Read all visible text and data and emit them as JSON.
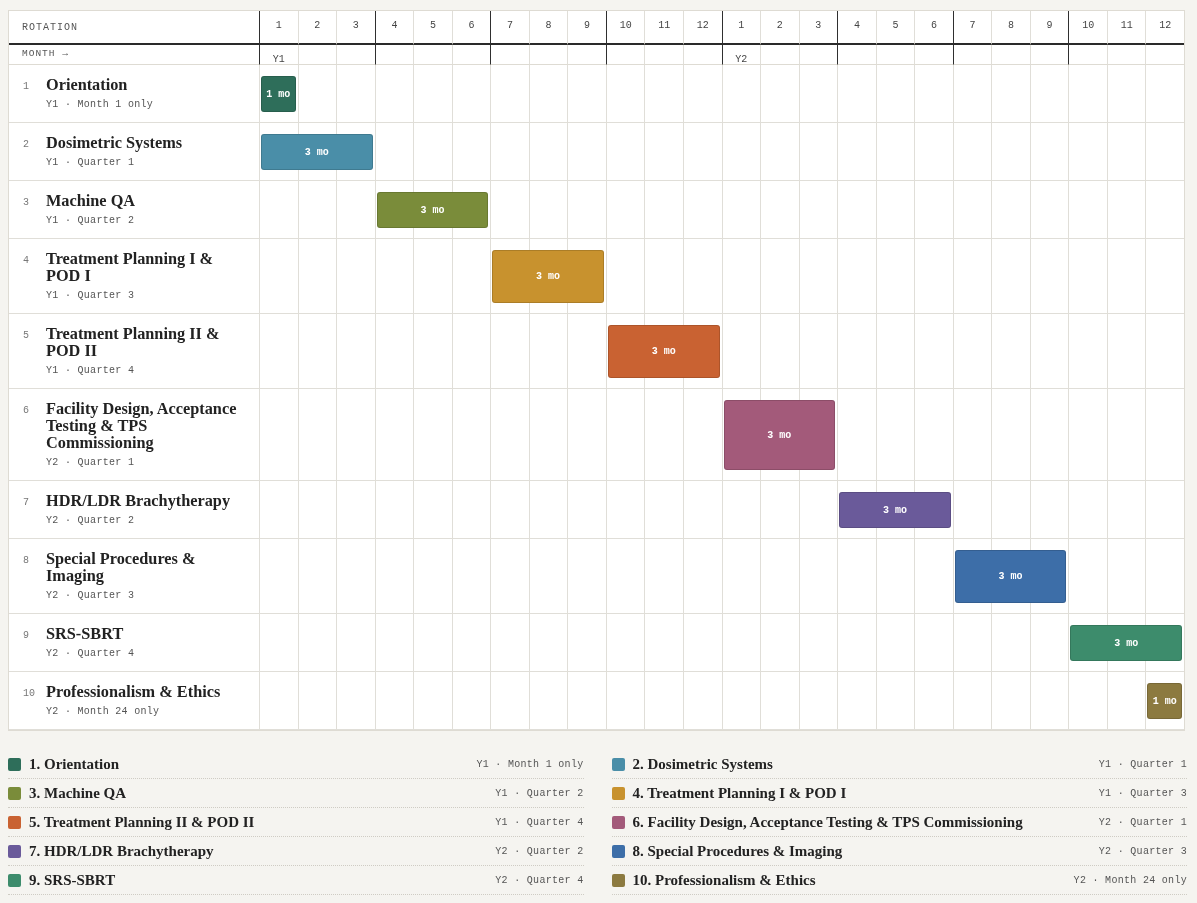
{
  "header": {
    "rotation_label": "ROTATION",
    "month_label": "MONTH →",
    "years": [
      {
        "label": "Y1",
        "months": [
          "1",
          "2",
          "3",
          "4",
          "5",
          "6",
          "7",
          "8",
          "9",
          "10",
          "11",
          "12"
        ]
      },
      {
        "label": "Y2",
        "months": [
          "1",
          "2",
          "3",
          "4",
          "5",
          "6",
          "7",
          "8",
          "9",
          "10",
          "11",
          "12"
        ]
      }
    ]
  },
  "rotations": [
    {
      "number": "1",
      "title": "Orientation",
      "period": "Y1 · Month 1 only",
      "color": "#2e6e5a",
      "bar_label": "1 mo",
      "months": [
        true,
        false,
        false,
        false,
        false,
        false,
        false,
        false,
        false,
        false,
        false,
        false,
        false,
        false,
        false,
        false,
        false,
        false,
        false,
        false,
        false,
        false,
        false,
        false
      ]
    },
    {
      "number": "2",
      "title": "Dosimetric Systems",
      "period": "Y1 · Quarter 1",
      "color": "#4a8ea8",
      "bar_label": "3 mo",
      "months": [
        true,
        true,
        true,
        false,
        false,
        false,
        false,
        false,
        false,
        false,
        false,
        false,
        false,
        false,
        false,
        false,
        false,
        false,
        false,
        false,
        false,
        false,
        false,
        false
      ]
    },
    {
      "number": "3",
      "title": "Machine QA",
      "period": "Y1 · Quarter 2",
      "color": "#7a8c3a",
      "bar_label": "3 mo",
      "months": [
        false,
        false,
        false,
        true,
        true,
        true,
        false,
        false,
        false,
        false,
        false,
        false,
        false,
        false,
        false,
        false,
        false,
        false,
        false,
        false,
        false,
        false,
        false,
        false
      ]
    },
    {
      "number": "4",
      "title": "Treatment Planning I & POD I",
      "period": "Y1 · Quarter 3",
      "color": "#c8922e",
      "bar_label": "3 mo",
      "months": [
        false,
        false,
        false,
        false,
        false,
        false,
        true,
        true,
        true,
        false,
        false,
        false,
        false,
        false,
        false,
        false,
        false,
        false,
        false,
        false,
        false,
        false,
        false,
        false
      ]
    },
    {
      "number": "5",
      "title": "Treatment Planning II & POD II",
      "period": "Y1 · Quarter 4",
      "color": "#c96232",
      "bar_label": "3 mo",
      "months": [
        false,
        false,
        false,
        false,
        false,
        false,
        false,
        false,
        false,
        true,
        true,
        true,
        false,
        false,
        false,
        false,
        false,
        false,
        false,
        false,
        false,
        false,
        false,
        false
      ]
    },
    {
      "number": "6",
      "title": "Facility Design, Acceptance Testing & TPS Commissioning",
      "period": "Y2 · Quarter 1",
      "color": "#a35a7a",
      "bar_label": "3 mo",
      "months": [
        false,
        false,
        false,
        false,
        false,
        false,
        false,
        false,
        false,
        false,
        false,
        false,
        true,
        true,
        true,
        false,
        false,
        false,
        false,
        false,
        false,
        false,
        false,
        false
      ]
    },
    {
      "number": "7",
      "title": "HDR/LDR Brachytherapy",
      "period": "Y2 · Quarter 2",
      "color": "#6a5a9a",
      "bar_label": "3 mo",
      "months": [
        false,
        false,
        false,
        false,
        false,
        false,
        false,
        false,
        false,
        false,
        false,
        false,
        false,
        false,
        false,
        true,
        true,
        true,
        false,
        false,
        false,
        false,
        false,
        false
      ]
    },
    {
      "number": "8",
      "title": "Special Procedures & Imaging",
      "period": "Y2 · Quarter 3",
      "color": "#3d6ea8",
      "bar_label": "3 mo",
      "months": [
        false,
        false,
        false,
        false,
        false,
        false,
        false,
        false,
        false,
        false,
        false,
        false,
        false,
        false,
        false,
        false,
        false,
        false,
        true,
        true,
        true,
        false,
        false,
        false
      ]
    },
    {
      "number": "9",
      "title": "SRS-SBRT",
      "period": "Y2 · Quarter 4",
      "color": "#3d8c6c",
      "bar_label": "3 mo",
      "months": [
        false,
        false,
        false,
        false,
        false,
        false,
        false,
        false,
        false,
        false,
        false,
        false,
        false,
        false,
        false,
        false,
        false,
        false,
        false,
        false,
        false,
        true,
        true,
        true
      ]
    },
    {
      "number": "10",
      "title": "Professionalism & Ethics",
      "period": "Y2 · Month 24 only",
      "color": "#8c7a40",
      "bar_label": "1 mo",
      "months": [
        false,
        false,
        false,
        false,
        false,
        false,
        false,
        false,
        false,
        false,
        false,
        false,
        false,
        false,
        false,
        false,
        false,
        false,
        false,
        false,
        false,
        false,
        false,
        true
      ]
    }
  ],
  "legend": [
    {
      "title": "1. Orientation",
      "period": "Y1 · Month 1 only",
      "color": "#2e6e5a"
    },
    {
      "title": "2. Dosimetric Systems",
      "period": "Y1 · Quarter 1",
      "color": "#4a8ea8"
    },
    {
      "title": "3. Machine QA",
      "period": "Y1 · Quarter 2",
      "color": "#7a8c3a"
    },
    {
      "title": "4. Treatment Planning I & POD I",
      "period": "Y1 · Quarter 3",
      "color": "#c8922e"
    },
    {
      "title": "5. Treatment Planning II & POD II",
      "period": "Y1 · Quarter 4",
      "color": "#c96232"
    },
    {
      "title": "6. Facility Design, Acceptance Testing & TPS Commissioning",
      "period": "Y2 · Quarter 1",
      "color": "#a35a7a"
    },
    {
      "title": "7. HDR/LDR Brachytherapy",
      "period": "Y2 · Quarter 2",
      "color": "#6a5a9a"
    },
    {
      "title": "8. Special Procedures & Imaging",
      "period": "Y2 · Quarter 3",
      "color": "#3d6ea8"
    },
    {
      "title": "9. SRS-SBRT",
      "period": "Y2 · Quarter 4",
      "color": "#3d8c6c"
    },
    {
      "title": "10. Professionalism & Ethics",
      "period": "Y2 · Month 24 only",
      "color": "#8c7a40"
    }
  ]
}
